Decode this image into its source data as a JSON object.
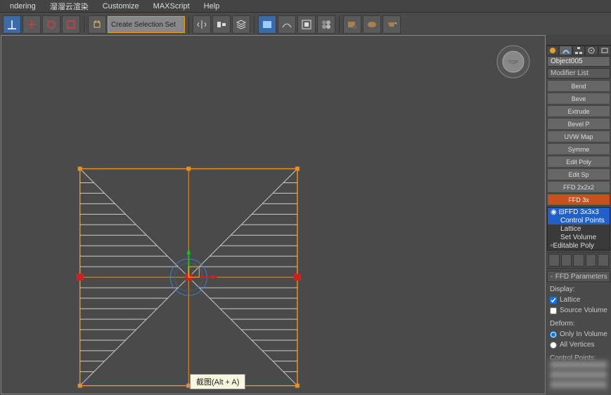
{
  "menu": {
    "items": [
      "ndering",
      "溜溜云渲染",
      "Customize",
      "MAXScript",
      "Help"
    ]
  },
  "toolbar": {
    "selset_label": "Create Selection Set"
  },
  "viewport": {
    "tooltip": "截图(Alt + A)",
    "cube_face": "TOP"
  },
  "panel": {
    "object_name": "Object005",
    "modlist_label": "Modifier List",
    "mod_buttons": [
      {
        "label": "Bend",
        "active": false
      },
      {
        "label": "Beve",
        "active": false
      },
      {
        "label": "Extrude",
        "active": false
      },
      {
        "label": "Bevel P",
        "active": false
      },
      {
        "label": "UVW Map",
        "active": false
      },
      {
        "label": "Symme",
        "active": false
      },
      {
        "label": "Edit Poly",
        "active": false
      },
      {
        "label": "Edit Sp",
        "active": false
      },
      {
        "label": "FFD 2x2x2",
        "active": false
      },
      {
        "label": "FFD 3x",
        "active": true
      }
    ],
    "stack": [
      {
        "label": "FFD 3x3x3",
        "sel": true,
        "sub": false
      },
      {
        "label": "Control Points",
        "sel": true,
        "sub": true
      },
      {
        "label": "Lattice",
        "sel": false,
        "sub": true
      },
      {
        "label": "Set Volume",
        "sel": false,
        "sub": true
      },
      {
        "label": "Editable Poly",
        "sel": false,
        "sub": false
      }
    ],
    "rollout_title": "FFD Parameters",
    "display_label": "Display:",
    "lattice_label": "Lattice",
    "lattice_checked": true,
    "srcvol_label": "Source Volume",
    "srcvol_checked": false,
    "deform_label": "Deform:",
    "onlyvol_label": "Only In Volume",
    "allvert_label": "All Vertices",
    "deform_value": "only",
    "cpoints_label": "Control Points:",
    "reset_label": "Reset",
    "animall_label": "Animate All"
  },
  "colors": {
    "accent": "#e89020",
    "select": "#2060c8",
    "gizmo_red": "#d02020"
  }
}
